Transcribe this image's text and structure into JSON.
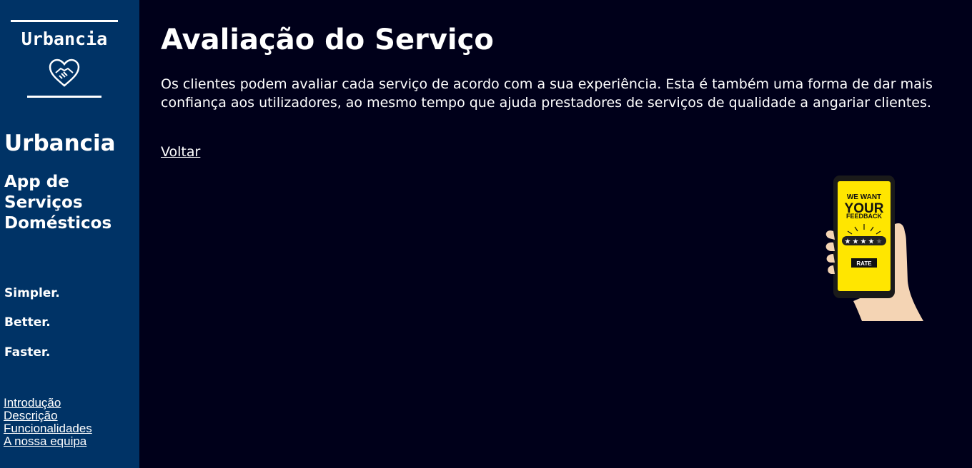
{
  "sidebar": {
    "logo": {
      "text": "Urbancia",
      "icon": "heart-handshake-icon"
    },
    "brand": "Urbancia",
    "tagline": "App de Serviços Domésticos",
    "slogans": [
      "Simpler.",
      "Better.",
      "Faster."
    ],
    "nav": [
      "Introdução",
      "Descrição",
      "Funcionalidades",
      "A nossa equipa"
    ]
  },
  "main": {
    "title": "Avaliação do Serviço",
    "description": "Os clientes podem avaliar cada serviço de acordo com a sua experiência. Esta é também uma forma de dar mais confiança aos utilizadores, ao mesmo tempo que ajuda prestadores de serviços de qualidade a angariar clientes.",
    "back_link": "Voltar",
    "feedback_image": {
      "line1": "WE WANT",
      "line2": "YOUR",
      "line3": "FEEDBACK",
      "button": "RATE",
      "stars_filled": 4,
      "stars_total": 5
    }
  },
  "colors": {
    "sidebar_bg": "#003366",
    "page_bg": "#00001a",
    "phone_screen": "#ffe600"
  }
}
